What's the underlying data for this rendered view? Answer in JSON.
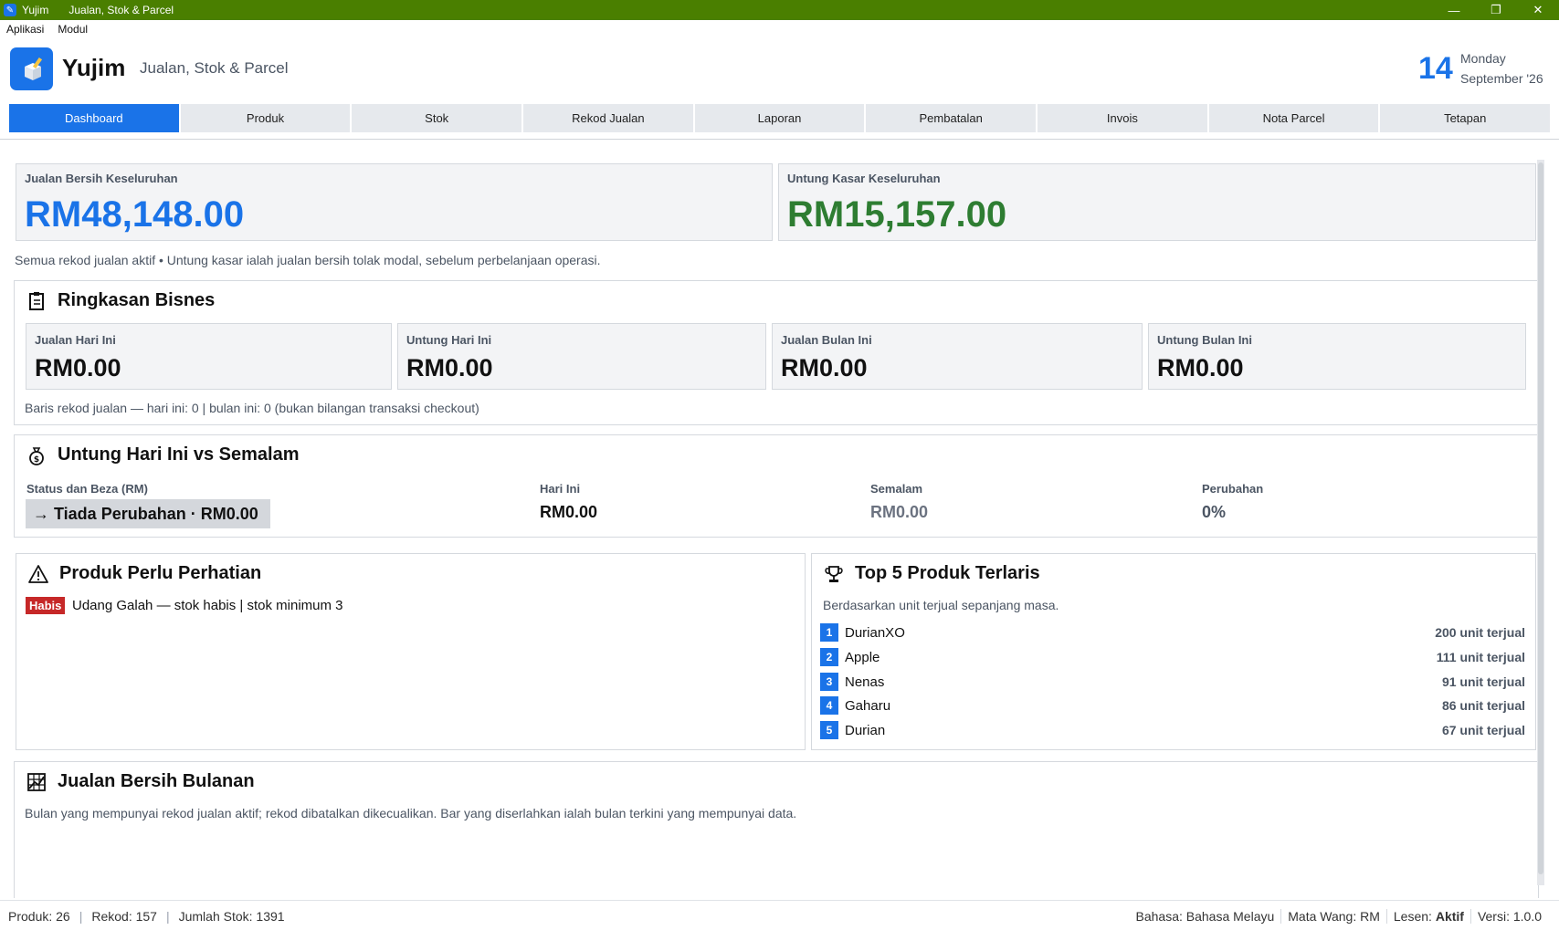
{
  "window": {
    "app_title": "Yujim",
    "doc_title": "Jualan, Stok & Parcel",
    "minimize": "—",
    "restore": "❐",
    "close": "✕"
  },
  "menu": [
    "Aplikasi",
    "Modul"
  ],
  "header": {
    "app_name": "Yujim",
    "subtitle": "Jualan, Stok & Parcel",
    "date_day": "14",
    "date_weekday": "Monday",
    "date_month_year": "September '26"
  },
  "tabs": [
    "Dashboard",
    "Produk",
    "Stok",
    "Rekod Jualan",
    "Laporan",
    "Pembatalan",
    "Invois",
    "Nota Parcel",
    "Tetapan"
  ],
  "active_tab": "Dashboard",
  "kpi": {
    "sales_label": "Jualan Bersih Keseluruhan",
    "sales_value": "RM48,148.00",
    "profit_label": "Untung Kasar Keseluruhan",
    "profit_value": "RM15,157.00",
    "note": "Semua rekod jualan aktif • Untung kasar ialah jualan bersih tolak modal, sebelum perbelanjaan operasi."
  },
  "summary": {
    "title": "Ringkasan Bisnes",
    "cards": [
      {
        "label": "Jualan Hari Ini",
        "value": "RM0.00"
      },
      {
        "label": "Untung Hari Ini",
        "value": "RM0.00"
      },
      {
        "label": "Jualan Bulan Ini",
        "value": "RM0.00"
      },
      {
        "label": "Untung Bulan Ini",
        "value": "RM0.00"
      }
    ],
    "note": "Baris rekod jualan — hari ini: 0 | bulan ini: 0 (bukan bilangan transaksi checkout)"
  },
  "compare": {
    "title": "Untung Hari Ini vs Semalam",
    "status_label": "Status dan Beza (RM)",
    "status_value": "→  Tiada Perubahan · RM0.00",
    "today_label": "Hari Ini",
    "today_value": "RM0.00",
    "yesterday_label": "Semalam",
    "yesterday_value": "RM0.00",
    "change_label": "Perubahan",
    "change_value": "0%"
  },
  "attention": {
    "title": "Produk Perlu Perhatian",
    "badge": "Habis",
    "text": "Udang Galah — stok habis | stok minimum 3"
  },
  "top5": {
    "title": "Top 5 Produk Terlaris",
    "subtitle": "Berdasarkan unit terjual sepanjang masa.",
    "items": [
      {
        "rank": "1",
        "name": "DurianXO",
        "units": "200 unit terjual"
      },
      {
        "rank": "2",
        "name": "Apple",
        "units": "111 unit terjual"
      },
      {
        "rank": "3",
        "name": "Nenas",
        "units": "91 unit terjual"
      },
      {
        "rank": "4",
        "name": "Gaharu",
        "units": "86 unit terjual"
      },
      {
        "rank": "5",
        "name": "Durian",
        "units": "67 unit terjual"
      }
    ]
  },
  "monthly": {
    "title": "Jualan Bersih Bulanan",
    "note": "Bulan yang mempunyai rekod jualan aktif; rekod dibatalkan dikecualikan. Bar yang diserlahkan ialah bulan terkini yang mempunyai data."
  },
  "statusbar": {
    "produk": "Produk: 26",
    "rekod": "Rekod: 157",
    "stok": "Jumlah Stok: 1391",
    "bahasa": "Bahasa: Bahasa Melayu",
    "mata_wang": "Mata Wang: RM",
    "lesen_label": "Lesen: ",
    "lesen_value": "Aktif",
    "versi": "Versi: 1.0.0"
  },
  "colors": {
    "titlebar": "#4a7f00",
    "accent": "#1a73e8",
    "profit": "#2e7d32",
    "danger": "#c62828"
  }
}
